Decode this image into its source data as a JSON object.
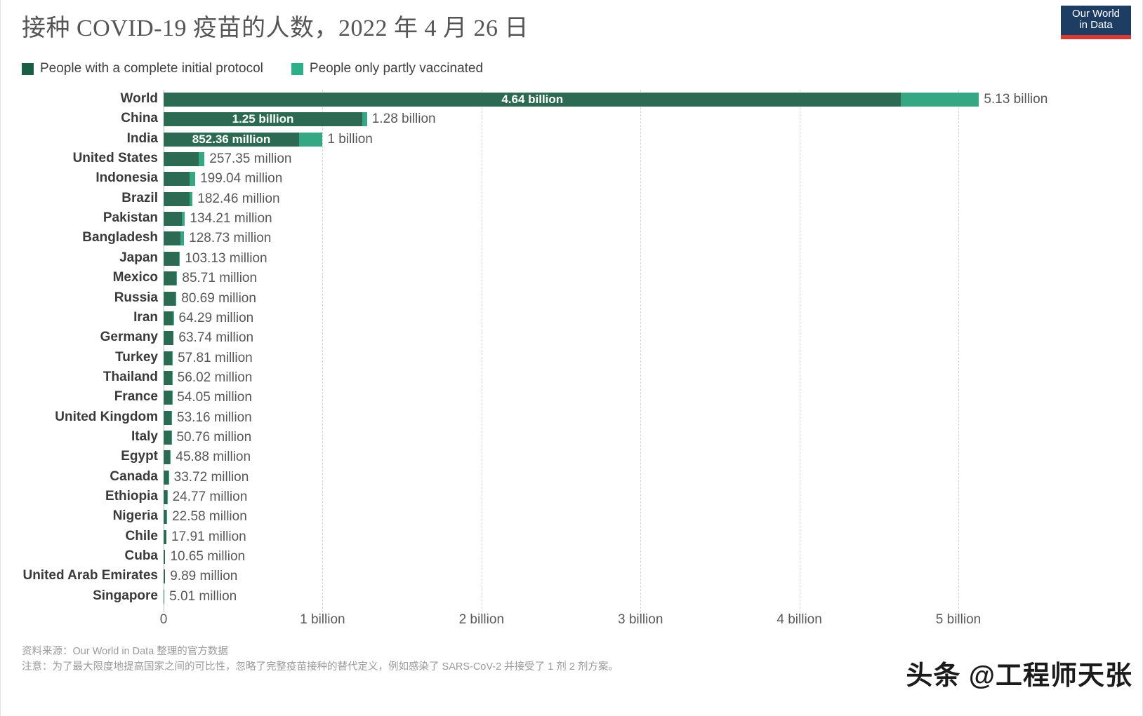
{
  "header": {
    "title": "接种 COVID-19 疫苗的人数，2022 年 4 月 26 日",
    "logo_line1": "Our World",
    "logo_line2": "in Data"
  },
  "legend": [
    {
      "label": "People with a complete initial protocol",
      "color": "#1b5e46"
    },
    {
      "label": "People only partly vaccinated",
      "color": "#2cb089"
    }
  ],
  "colors": {
    "full": "#2d6a54",
    "partial": "#35a883",
    "gridline": "#d2d2d2",
    "axis": "#b7b7b7",
    "logo_bg": "#1d3d63",
    "logo_rule": "#d93a33"
  },
  "footer": {
    "source": "资料来源：Our World in Data 整理的官方数据",
    "note": "注意：为了最大限度地提高国家之间的可比性，忽略了完整疫苗接种的替代定义，例如感染了 SARS-CoV-2 并接受了 1 剂 2 剂方案。",
    "watermark": "头条 @工程师天张"
  },
  "chart_data": {
    "type": "bar",
    "orientation": "horizontal",
    "stacked": true,
    "title": "接种 COVID-19 疫苗的人数，2022 年 4 月 26 日",
    "xlabel": "",
    "ylabel": "",
    "xlim": [
      0,
      5600000000
    ],
    "grid": true,
    "legend_position": "top-left",
    "xticks": [
      0,
      1000000000,
      2000000000,
      3000000000,
      4000000000,
      5000000000
    ],
    "xticklabels": [
      "0",
      "1 billion",
      "2 billion",
      "3 billion",
      "4 billion",
      "5 billion"
    ],
    "series": [
      {
        "name": "People with a complete initial protocol",
        "color": "#2d6a54"
      },
      {
        "name": "People only partly vaccinated",
        "color": "#35a883"
      }
    ],
    "categories": [
      "World",
      "China",
      "India",
      "United States",
      "Indonesia",
      "Brazil",
      "Pakistan",
      "Bangladesh",
      "Japan",
      "Mexico",
      "Russia",
      "Iran",
      "Germany",
      "Turkey",
      "Thailand",
      "France",
      "United Kingdom",
      "Italy",
      "Egypt",
      "Canada",
      "Ethiopia",
      "Nigeria",
      "Chile",
      "Cuba",
      "United Arab Emirates",
      "Singapore"
    ],
    "rows": [
      {
        "label": "World",
        "full": 4640000000,
        "total": 5130000000,
        "full_text": "4.64 billion",
        "total_text": "5.13 billion",
        "full_label_inside": true
      },
      {
        "label": "China",
        "full": 1250000000,
        "total": 1280000000,
        "full_text": "1.25 billion",
        "total_text": "1.28 billion",
        "full_label_inside": true
      },
      {
        "label": "India",
        "full": 852360000,
        "total": 1000000000,
        "full_text": "852.36 million",
        "total_text": "1 billion",
        "full_label_inside": true
      },
      {
        "label": "United States",
        "full": 220000000,
        "total": 257350000,
        "full_text": "",
        "total_text": "257.35 million",
        "full_label_inside": false
      },
      {
        "label": "Indonesia",
        "full": 165000000,
        "total": 199040000,
        "full_text": "",
        "total_text": "199.04 million",
        "full_label_inside": false
      },
      {
        "label": "Brazil",
        "full": 162000000,
        "total": 182460000,
        "full_text": "",
        "total_text": "182.46 million",
        "full_label_inside": false
      },
      {
        "label": "Pakistan",
        "full": 113000000,
        "total": 134210000,
        "full_text": "",
        "total_text": "134.21 million",
        "full_label_inside": false
      },
      {
        "label": "Bangladesh",
        "full": 105000000,
        "total": 128730000,
        "full_text": "",
        "total_text": "128.73 million",
        "full_label_inside": false
      },
      {
        "label": "Japan",
        "full": 99000000,
        "total": 103130000,
        "full_text": "",
        "total_text": "103.13 million",
        "full_label_inside": false
      },
      {
        "label": "Mexico",
        "full": 78000000,
        "total": 85710000,
        "full_text": "",
        "total_text": "85.71 million",
        "full_label_inside": false
      },
      {
        "label": "Russia",
        "full": 75000000,
        "total": 80690000,
        "full_text": "",
        "total_text": "80.69 million",
        "full_label_inside": false
      },
      {
        "label": "Iran",
        "full": 59000000,
        "total": 64290000,
        "full_text": "",
        "total_text": "64.29 million",
        "full_label_inside": false
      },
      {
        "label": "Germany",
        "full": 62000000,
        "total": 63740000,
        "full_text": "",
        "total_text": "63.74 million",
        "full_label_inside": false
      },
      {
        "label": "Turkey",
        "full": 52000000,
        "total": 57810000,
        "full_text": "",
        "total_text": "57.81 million",
        "full_label_inside": false
      },
      {
        "label": "Thailand",
        "full": 51000000,
        "total": 56020000,
        "full_text": "",
        "total_text": "56.02 million",
        "full_label_inside": false
      },
      {
        "label": "France",
        "full": 52000000,
        "total": 54050000,
        "full_text": "",
        "total_text": "54.05 million",
        "full_label_inside": false
      },
      {
        "label": "United Kingdom",
        "full": 48000000,
        "total": 53160000,
        "full_text": "",
        "total_text": "53.16 million",
        "full_label_inside": false
      },
      {
        "label": "Italy",
        "full": 48500000,
        "total": 50760000,
        "full_text": "",
        "total_text": "50.76 million",
        "full_label_inside": false
      },
      {
        "label": "Egypt",
        "full": 38000000,
        "total": 45880000,
        "full_text": "",
        "total_text": "45.88 million",
        "full_label_inside": false
      },
      {
        "label": "Canada",
        "full": 31500000,
        "total": 33720000,
        "full_text": "",
        "total_text": "33.72 million",
        "full_label_inside": false
      },
      {
        "label": "Ethiopia",
        "full": 22500000,
        "total": 24770000,
        "full_text": "",
        "total_text": "24.77 million",
        "full_label_inside": false
      },
      {
        "label": "Nigeria",
        "full": 17500000,
        "total": 22580000,
        "full_text": "",
        "total_text": "22.58 million",
        "full_label_inside": false
      },
      {
        "label": "Chile",
        "full": 17000000,
        "total": 17910000,
        "full_text": "",
        "total_text": "17.91 million",
        "full_label_inside": false
      },
      {
        "label": "Cuba",
        "full": 9900000,
        "total": 10650000,
        "full_text": "",
        "total_text": "10.65 million",
        "full_label_inside": false
      },
      {
        "label": "United Arab Emirates",
        "full": 9500000,
        "total": 9890000,
        "full_text": "",
        "total_text": "9.89 million",
        "full_label_inside": false
      },
      {
        "label": "Singapore",
        "full": 4800000,
        "total": 5010000,
        "full_text": "",
        "total_text": "5.01 million",
        "full_label_inside": false
      }
    ]
  }
}
